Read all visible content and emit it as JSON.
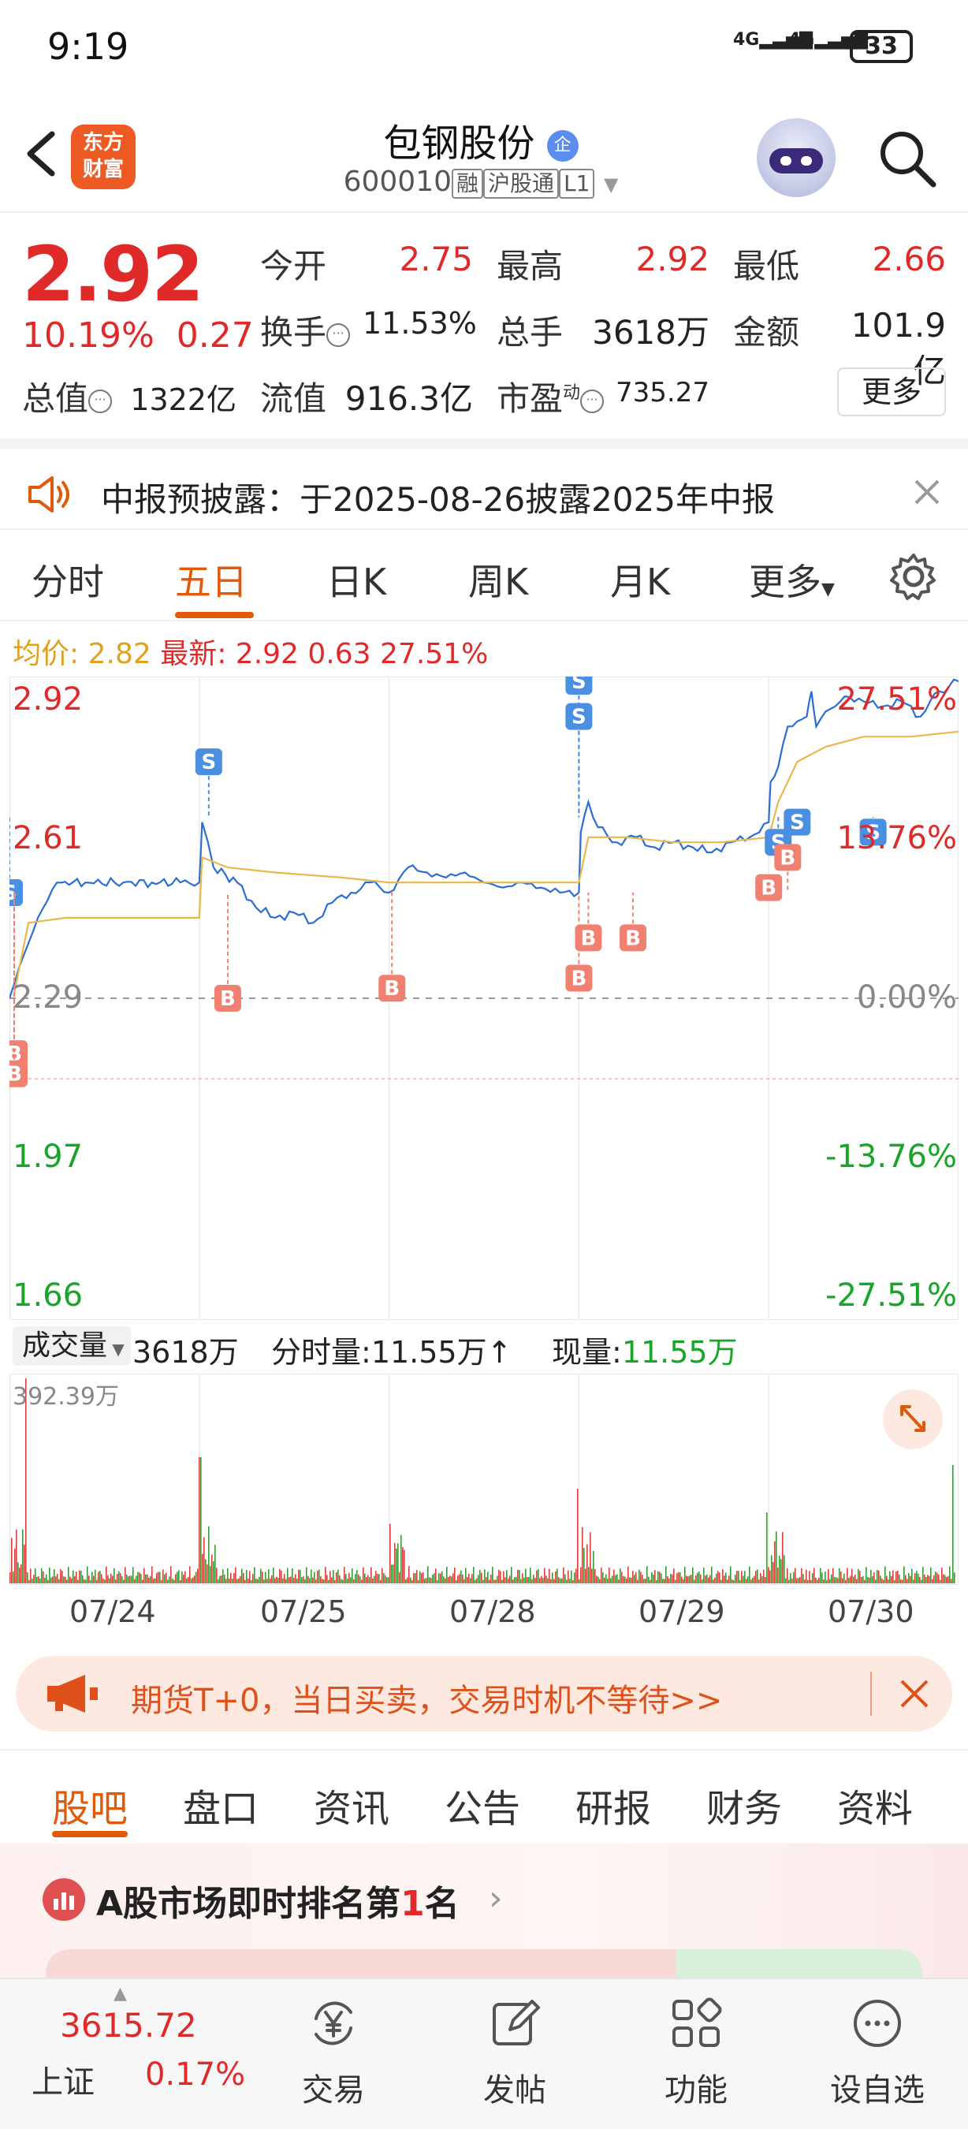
{
  "status_bar": {
    "time": "9:19",
    "signal1": "4G",
    "signal2": "4G",
    "battery": "33"
  },
  "header": {
    "logo_line1": "东方",
    "logo_line2": "财富",
    "title": "包钢股份",
    "title_badge": "企",
    "code": "600010",
    "tags": [
      "融",
      "沪股通",
      "L1"
    ]
  },
  "quote": {
    "price": "2.92",
    "change_pct": "10.19%",
    "change_amt": "0.27",
    "fields": [
      {
        "label": "今开",
        "value": "2.75"
      },
      {
        "label": "最高",
        "value": "2.92"
      },
      {
        "label": "最低",
        "value": "2.66"
      },
      {
        "label": "换手",
        "value": "11.53%"
      },
      {
        "label": "总手",
        "value": "3618万"
      },
      {
        "label": "金额",
        "value": "101.9亿"
      },
      {
        "label": "总值",
        "value": "1322亿"
      },
      {
        "label": "流值",
        "value": "916.3亿"
      },
      {
        "label": "市盈",
        "label_sup": "动",
        "value": "735.27"
      }
    ],
    "more_label": "更多"
  },
  "notice": {
    "text": "中报预披露：于2025-08-26披露2025年中报"
  },
  "tabs": [
    "分时",
    "五日",
    "日K",
    "周K",
    "月K",
    "更多"
  ],
  "active_tab": "五日",
  "info": {
    "avg_label": "均价:",
    "avg_value": "2.82",
    "latest_label": "最新:",
    "latest_value": "2.92",
    "chg": "0.63",
    "pct": "27.51%"
  },
  "chart_data": {
    "type": "line",
    "title": "",
    "y_labels_left": [
      "2.92",
      "2.61",
      "2.29",
      "1.97",
      "1.66"
    ],
    "y_labels_right": [
      "27.51%",
      "13.76%",
      "0.00%",
      "-13.76%",
      "-27.51%"
    ],
    "ylim": [
      1.66,
      2.92
    ],
    "baseline": 2.29,
    "x_dates": [
      "07/24",
      "07/25",
      "07/28",
      "07/29",
      "07/30"
    ],
    "series": [
      {
        "name": "price",
        "x": [
          0,
          0.01,
          0.03,
          0.05,
          0.08,
          0.12,
          0.15,
          0.18,
          0.2,
          0.203,
          0.215,
          0.24,
          0.26,
          0.28,
          0.3,
          0.32,
          0.34,
          0.36,
          0.38,
          0.4,
          0.42,
          0.44,
          0.46,
          0.48,
          0.5,
          0.52,
          0.54,
          0.56,
          0.58,
          0.6,
          0.602,
          0.61,
          0.62,
          0.64,
          0.66,
          0.68,
          0.7,
          0.72,
          0.74,
          0.76,
          0.78,
          0.8,
          0.802,
          0.81,
          0.82,
          0.84,
          0.845,
          0.85,
          0.86,
          0.87,
          0.88,
          0.9,
          0.92,
          0.94,
          0.96,
          0.97,
          0.98,
          1.0
        ],
        "y": [
          2.29,
          2.35,
          2.45,
          2.52,
          2.52,
          2.52,
          2.52,
          2.52,
          2.52,
          2.64,
          2.55,
          2.52,
          2.47,
          2.45,
          2.46,
          2.44,
          2.48,
          2.5,
          2.52,
          2.5,
          2.55,
          2.54,
          2.53,
          2.54,
          2.52,
          2.51,
          2.52,
          2.51,
          2.5,
          2.5,
          2.62,
          2.68,
          2.63,
          2.6,
          2.61,
          2.59,
          2.6,
          2.59,
          2.58,
          2.6,
          2.61,
          2.64,
          2.72,
          2.75,
          2.83,
          2.85,
          2.9,
          2.83,
          2.86,
          2.87,
          2.89,
          2.88,
          2.87,
          2.88,
          2.85,
          2.88,
          2.9,
          2.92
        ]
      },
      {
        "name": "avg",
        "x": [
          0.005,
          0.02,
          0.06,
          0.1,
          0.14,
          0.2,
          0.203,
          0.23,
          0.28,
          0.35,
          0.4,
          0.45,
          0.5,
          0.55,
          0.6,
          0.61,
          0.65,
          0.7,
          0.75,
          0.8,
          0.81,
          0.83,
          0.86,
          0.9,
          0.95,
          1.0
        ],
        "y": [
          2.3,
          2.44,
          2.45,
          2.45,
          2.45,
          2.45,
          2.57,
          2.55,
          2.54,
          2.53,
          2.52,
          2.52,
          2.52,
          2.52,
          2.52,
          2.61,
          2.61,
          2.6,
          2.6,
          2.61,
          2.68,
          2.76,
          2.79,
          2.81,
          2.81,
          2.82
        ]
      }
    ],
    "signals": [
      {
        "type": "S",
        "x": 0.0,
        "y": 2.5
      },
      {
        "type": "B",
        "x": 0.005,
        "y": 2.18
      },
      {
        "type": "B",
        "x": 0.005,
        "y": 2.14
      },
      {
        "type": "S",
        "x": 0.21,
        "y": 2.76
      },
      {
        "type": "B",
        "x": 0.23,
        "y": 2.29
      },
      {
        "type": "B",
        "x": 0.403,
        "y": 2.31
      },
      {
        "type": "S",
        "x": 0.6,
        "y": 2.92
      },
      {
        "type": "S",
        "x": 0.6,
        "y": 2.85
      },
      {
        "type": "B",
        "x": 0.6,
        "y": 2.33
      },
      {
        "type": "B",
        "x": 0.61,
        "y": 2.41
      },
      {
        "type": "B",
        "x": 0.657,
        "y": 2.41
      },
      {
        "type": "S",
        "x": 0.81,
        "y": 2.6
      },
      {
        "type": "S",
        "x": 0.83,
        "y": 2.64
      },
      {
        "type": "B",
        "x": 0.82,
        "y": 2.57
      },
      {
        "type": "B",
        "x": 0.8,
        "y": 2.51
      },
      {
        "type": "S",
        "x": 0.91,
        "y": 2.62
      }
    ]
  },
  "volume": {
    "select_label": "成交量",
    "total": "3618万",
    "period_label": "分时量:",
    "period_value": "11.55万↑",
    "now_label": "现量:",
    "now_value": "11.55万",
    "max_label": "392.39万"
  },
  "promo": {
    "text": "期货T+0，当日买卖，交易时机不等待>>"
  },
  "section_tabs": [
    "股吧",
    "盘口",
    "资讯",
    "公告",
    "研报",
    "财务",
    "资料"
  ],
  "active_section": "股吧",
  "rank": {
    "text_before": "A股市场即时排名第",
    "rank": "1",
    "text_after": "名"
  },
  "bottom_nav": {
    "index_value": "3615.72",
    "index_name": "上证",
    "index_pct": "0.17%",
    "items": [
      {
        "label": "交易",
        "icon": "yen-exchange-icon"
      },
      {
        "label": "发帖",
        "icon": "edit-icon"
      },
      {
        "label": "功能",
        "icon": "grid-icon"
      },
      {
        "label": "设自选",
        "icon": "more-circle-icon"
      }
    ]
  },
  "colors": {
    "up": "#e02a2a",
    "down": "#1aa52a",
    "accent": "#e05a0a",
    "price_line": "#2b6ed3",
    "avg_line": "#e8b84a",
    "buy_badge": "#f08070",
    "sell_badge": "#4a90e2"
  }
}
